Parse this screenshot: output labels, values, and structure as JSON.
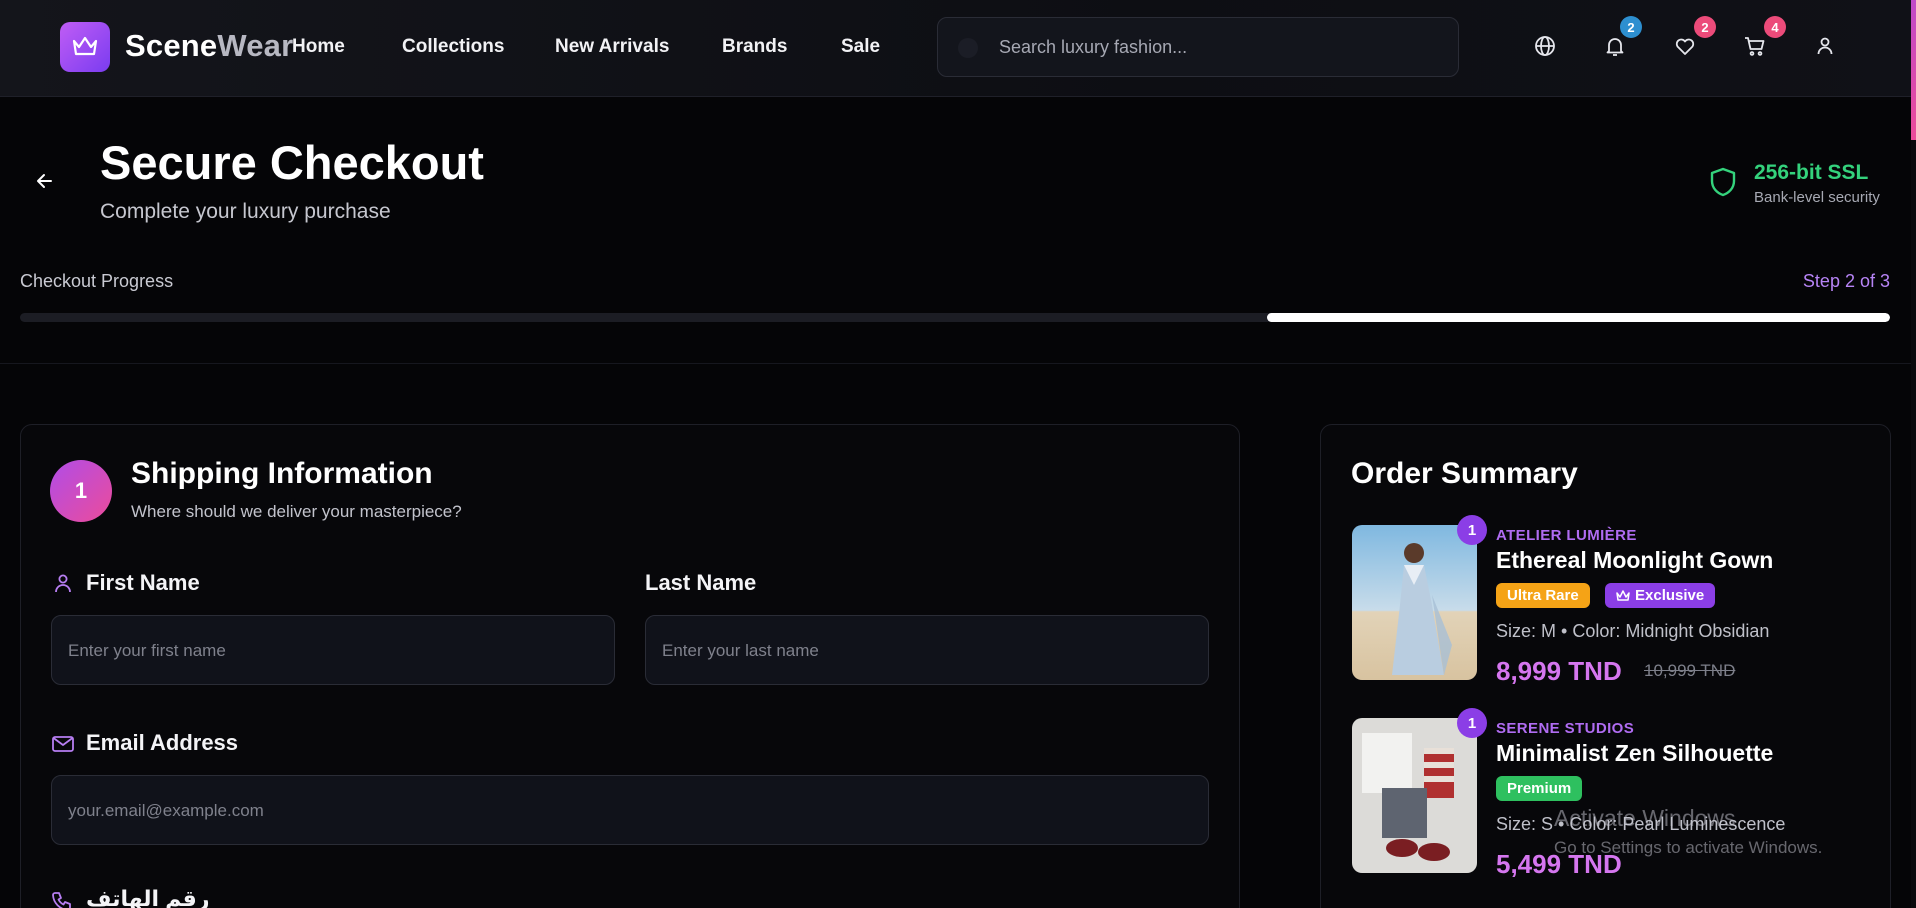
{
  "header": {
    "brand_part1": "Scene",
    "brand_part2": "Wear",
    "nav": [
      "Home",
      "Collections",
      "New Arrivals",
      "Brands",
      "Sale"
    ],
    "search_placeholder": "Search luxury fashion...",
    "badges": {
      "notifications": "2",
      "wishlist": "2",
      "cart": "4"
    },
    "icons": [
      "globe-icon",
      "bell-icon",
      "heart-icon",
      "cart-icon",
      "user-icon"
    ],
    "colors": {
      "accent": "#a855f7",
      "notif_badge": "#2d8fd0",
      "pink_badge": "#ec4b7a"
    }
  },
  "checkout": {
    "title": "Secure Checkout",
    "subtitle": "Complete your luxury purchase",
    "ssl_title": "256-bit SSL",
    "ssl_sub": "Bank-level security",
    "progress_label": "Checkout Progress",
    "progress_step": "Step 2 of 3",
    "progress_fraction": 0.333
  },
  "shipping": {
    "step_number": "1",
    "title": "Shipping Information",
    "subtitle": "Where should we deliver your masterpiece?",
    "first_name_label": "First Name",
    "first_name_placeholder": "Enter your first name",
    "last_name_label": "Last Name",
    "last_name_placeholder": "Enter your last name",
    "email_label": "Email Address",
    "email_placeholder": "your.email@example.com",
    "phone_label": "رقم الهاتف"
  },
  "summary": {
    "title": "Order Summary",
    "items": [
      {
        "qty": "1",
        "brand": "ATELIER LUMIÈRE",
        "name": "Ethereal Moonlight Gown",
        "tags": [
          "Ultra Rare",
          "Exclusive"
        ],
        "meta": "Size: M • Color: Midnight Obsidian",
        "price": "8,999 TND",
        "old_price": "10,999 TND"
      },
      {
        "qty": "1",
        "brand": "SERENE STUDIOS",
        "name": "Minimalist Zen Silhouette",
        "tags": [
          "Premium"
        ],
        "meta": "Size: S • Color: Pearl Luminescence",
        "price": "5,499 TND"
      }
    ]
  },
  "watermark": {
    "line1": "Activate Windows",
    "line2": "Go to Settings to activate Windows."
  }
}
